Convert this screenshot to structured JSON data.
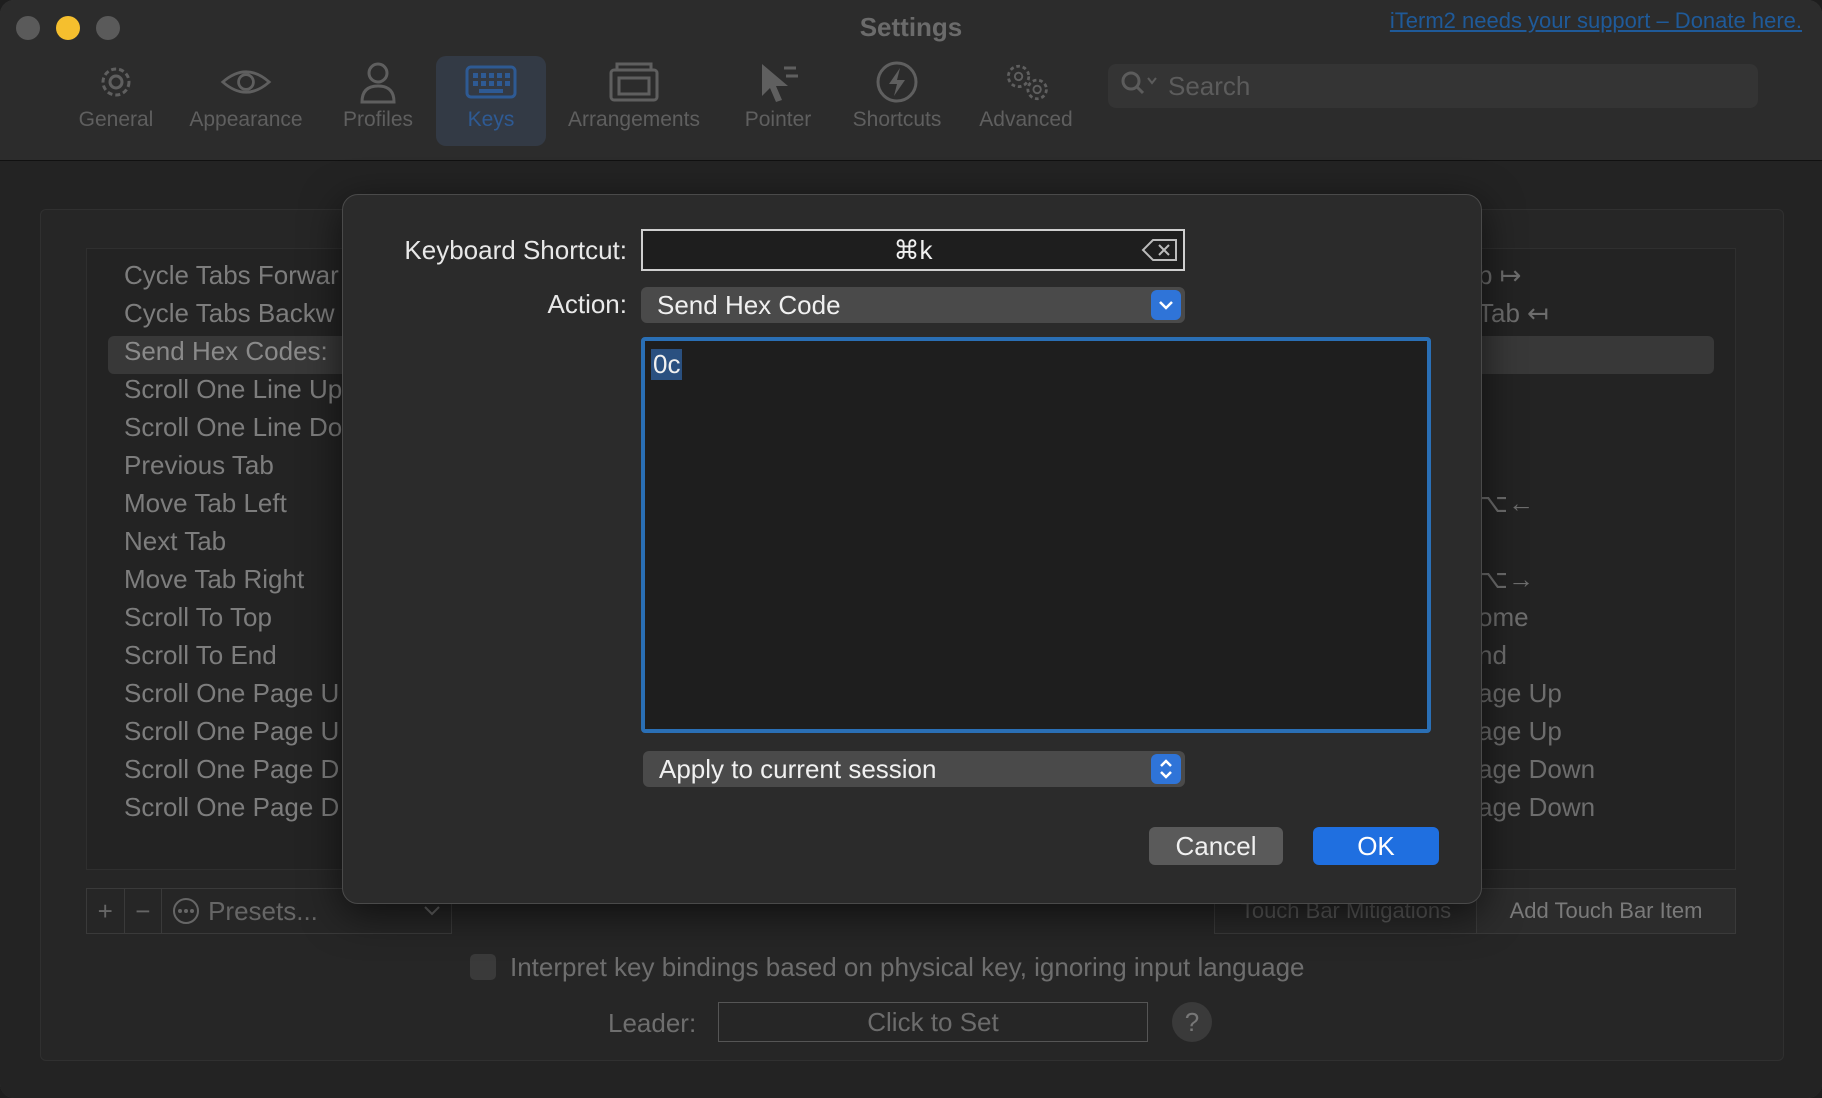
{
  "window": {
    "title": "Settings",
    "donate_link": "iTerm2 needs your support – Donate here."
  },
  "toolbar": {
    "items": [
      {
        "label": "General",
        "icon": "gear-icon"
      },
      {
        "label": "Appearance",
        "icon": "eye-icon"
      },
      {
        "label": "Profiles",
        "icon": "person-icon"
      },
      {
        "label": "Keys",
        "icon": "keyboard-icon",
        "active": true
      },
      {
        "label": "Arrangements",
        "icon": "windows-icon"
      },
      {
        "label": "Pointer",
        "icon": "pointer-icon"
      },
      {
        "label": "Shortcuts",
        "icon": "bolt-icon"
      },
      {
        "label": "Advanced",
        "icon": "gears-icon"
      }
    ],
    "search_placeholder": "Search"
  },
  "keys_list": {
    "left": [
      "Cycle Tabs Forwar",
      "Cycle Tabs Backw",
      "Send Hex Codes:",
      "Scroll One Line Up",
      "Scroll One Line Do",
      "Previous Tab",
      "Move Tab Left",
      "Next Tab",
      "Move Tab Right",
      "Scroll To Top",
      "Scroll To End",
      "Scroll One Page U",
      "Scroll One Page U",
      "Scroll One Page D",
      "Scroll One Page D"
    ],
    "right": [
      "b ↦",
      "Tab ↤",
      "",
      "",
      "",
      "",
      "⌥←",
      "",
      "⌥→",
      "ome",
      "nd",
      "age Up",
      "age Up",
      "age Down",
      "age Down"
    ],
    "selected_index": 2
  },
  "bottom_bar": {
    "add": "+",
    "remove": "−",
    "presets": "Presets...",
    "touch_bar_mitigations": "Touch Bar Mitigations",
    "add_touch_bar_item": "Add Touch Bar Item"
  },
  "options": {
    "physical_key_label": "Interpret key bindings based on physical key, ignoring input language",
    "leader_label": "Leader:",
    "leader_value": "Click to Set",
    "help": "?"
  },
  "dialog": {
    "shortcut_label": "Keyboard Shortcut:",
    "shortcut_value": "⌘k",
    "action_label": "Action:",
    "action_value": "Send Hex Code",
    "hex_value": "0c",
    "apply_value": "Apply to current session",
    "cancel": "Cancel",
    "ok": "OK"
  },
  "colors": {
    "accent": "#1f6fe0",
    "focus_ring": "#2a6fb5",
    "traffic_minimize": "#f5bf2e"
  }
}
